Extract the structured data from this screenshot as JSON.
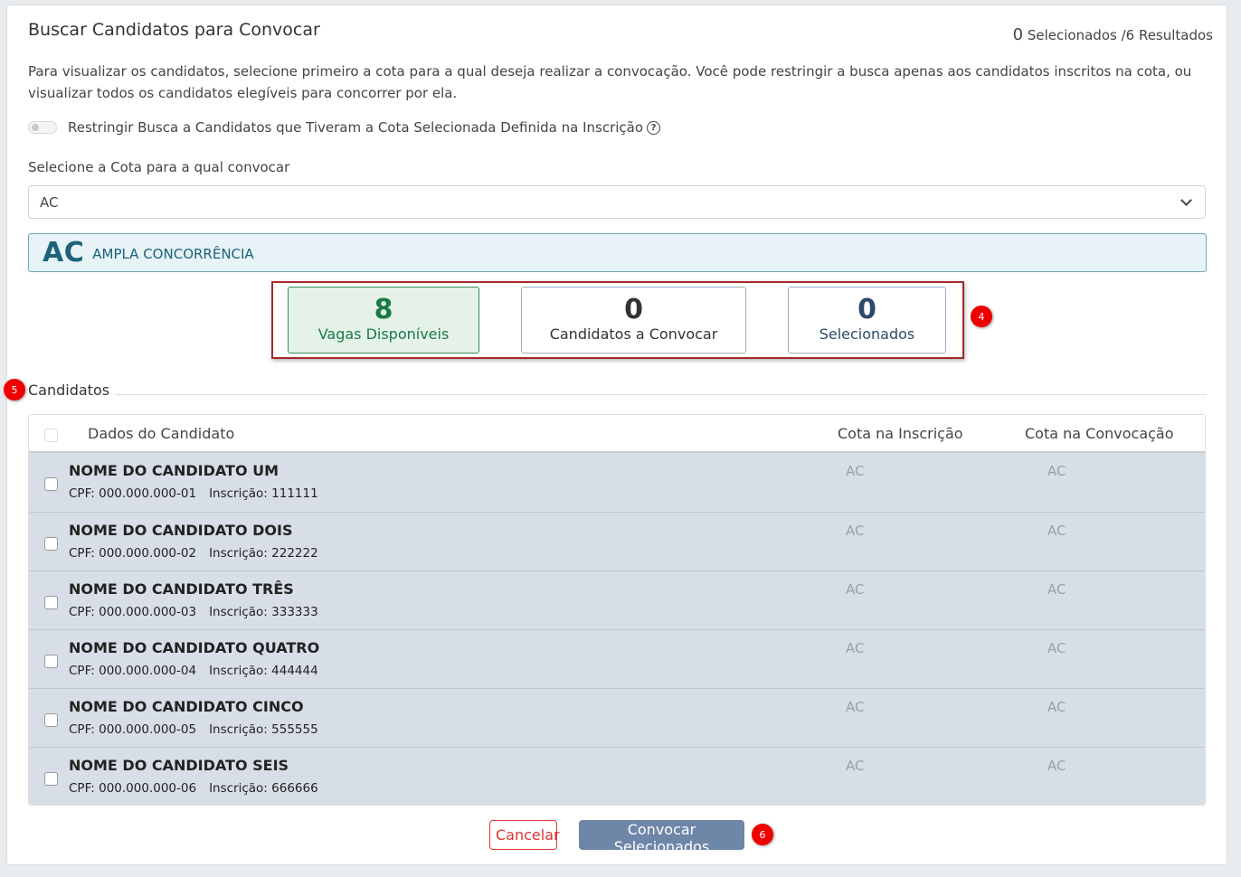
{
  "header": {
    "title": "Buscar Candidatos para Convocar",
    "selected_count": "0",
    "selected_label": "Selecionados /6 Resultados"
  },
  "description": "Para visualizar os candidatos, selecione primeiro a cota para a qual deseja realizar a convocação. Você pode restringir a busca apenas aos candidatos inscritos na cota, ou visualizar todos os candidatos elegíveis para concorrer por ela.",
  "toggle": {
    "label": "Restringir Busca a Candidatos que Tiveram a Cota Selecionada Definida na Inscrição",
    "help_glyph": "?"
  },
  "quota_select": {
    "label": "Selecione a Cota para a qual convocar",
    "value": "AC"
  },
  "quota_banner": {
    "code": "AC",
    "name": "AMPLA CONCORRÊNCIA"
  },
  "stats": {
    "vagas": {
      "value": "8",
      "label": "Vagas Disponíveis"
    },
    "candidatos": {
      "value": "0",
      "label": "Candidatos a Convocar"
    },
    "selecionados": {
      "value": "0",
      "label": "Selecionados"
    }
  },
  "badges": {
    "stats": "4",
    "section": "5",
    "actions": "6"
  },
  "section_title": "Candidatos",
  "table": {
    "headers": [
      "Dados do Candidato",
      "Cota na Inscrição",
      "Cota na Convocação"
    ],
    "rows": [
      {
        "name": "NOME DO CANDIDATO UM",
        "cpf": "CPF: 000.000.000-01",
        "inscricao": "Inscrição: 111111",
        "cota_inscricao": "AC",
        "cota_convocacao": "AC"
      },
      {
        "name": "NOME DO CANDIDATO DOIS",
        "cpf": "CPF: 000.000.000-02",
        "inscricao": "Inscrição: 222222",
        "cota_inscricao": "AC",
        "cota_convocacao": "AC"
      },
      {
        "name": "NOME DO CANDIDATO TRÊS",
        "cpf": "CPF: 000.000.000-03",
        "inscricao": "Inscrição: 333333",
        "cota_inscricao": "AC",
        "cota_convocacao": "AC"
      },
      {
        "name": "NOME DO CANDIDATO QUATRO",
        "cpf": "CPF: 000.000.000-04",
        "inscricao": "Inscrição: 444444",
        "cota_inscricao": "AC",
        "cota_convocacao": "AC"
      },
      {
        "name": "NOME DO CANDIDATO CINCO",
        "cpf": "CPF: 000.000.000-05",
        "inscricao": "Inscrição: 555555",
        "cota_inscricao": "AC",
        "cota_convocacao": "AC"
      },
      {
        "name": "NOME DO CANDIDATO SEIS",
        "cpf": "CPF: 000.000.000-06",
        "inscricao": "Inscrição: 666666",
        "cota_inscricao": "AC",
        "cota_convocacao": "AC"
      }
    ]
  },
  "actions": {
    "cancel": "Cancelar",
    "submit": "Convocar Selecionados"
  }
}
